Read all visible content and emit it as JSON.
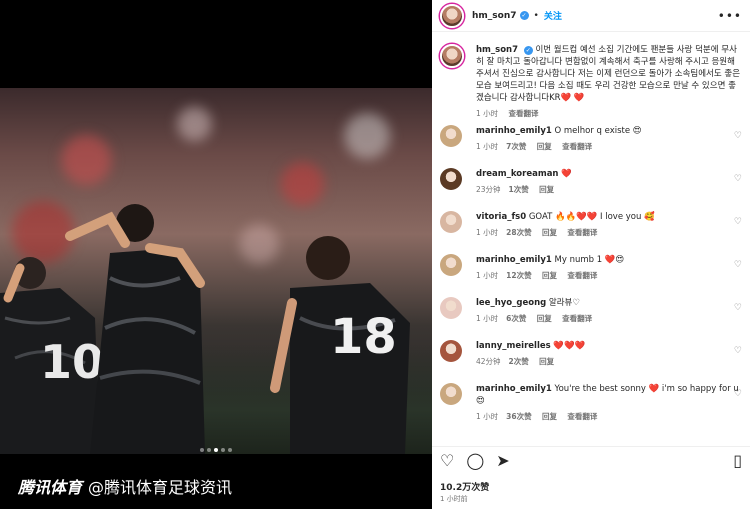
{
  "header": {
    "username": "hm_son7",
    "verified_mark": "✓",
    "dot": "•",
    "follow": "关注",
    "more": "•••"
  },
  "caption": {
    "username": "hm_son7",
    "text": "이번 월드컵 예선 소집 기간에도 팬분들 사랑 덕분에 무사히 잘 마치고 돌아갑니다 변함없이 계속해서 축구를 사랑해 주시고 응원해 주셔서 진심으로 감사합니다 저는 이제 런던으로 돌아가 소속팀에서도 좋은 모습 보여드리고! 다음 소집 때도 우리 건강한 모습으로 만날 수 있으면 좋겠습니다 감사합니다",
    "suffix": "KR❤️ ❤️",
    "time": "1 小时",
    "translate": "查看翻译"
  },
  "comments": [
    {
      "user": "marinho_emily1",
      "text": "O melhor q existe 😍",
      "time": "1 小时",
      "likes": "7次赞",
      "reply": "回复",
      "translate": "查看翻译"
    },
    {
      "user": "dream_koreaman",
      "text": "❤️",
      "time": "23分钟",
      "likes": "1次赞",
      "reply": "回复",
      "translate": ""
    },
    {
      "user": "vitoria_fs0",
      "text": "GOAT 🔥🔥❤️❤️ I love you 🥰",
      "time": "1 小时",
      "likes": "28次赞",
      "reply": "回复",
      "translate": "查看翻译"
    },
    {
      "user": "marinho_emily1",
      "text": "My numb 1 ❤️😍",
      "time": "1 小时",
      "likes": "12次赞",
      "reply": "回复",
      "translate": "查看翻译"
    },
    {
      "user": "lee_hyo_geong",
      "text": "알라뷰♡",
      "time": "1 小时",
      "likes": "6次赞",
      "reply": "回复",
      "translate": "查看翻译"
    },
    {
      "user": "lanny_meirelles",
      "text": "❤️❤️❤️",
      "time": "42分钟",
      "likes": "2次赞",
      "reply": "回复",
      "translate": ""
    },
    {
      "user": "marinho_emily1",
      "text": "You're the best sonny ❤️ i'm so happy for u 😍",
      "time": "1 小时",
      "likes": "36次赞",
      "reply": "回复",
      "translate": "查看翻译"
    }
  ],
  "stats": {
    "likes": "10.2万次赞",
    "posted": "1 小时前"
  },
  "watermark": {
    "brand": "腾讯体育",
    "account": "@腾讯体育足球资讯"
  },
  "player_numbers": {
    "left": "10",
    "right": "18"
  },
  "icons": [
    "heart-icon",
    "comment-icon",
    "share-icon",
    "bookmark-icon"
  ],
  "colors": {
    "follow": "#0095f6",
    "heart": "#ed2a47",
    "verified": "#3897f0"
  }
}
